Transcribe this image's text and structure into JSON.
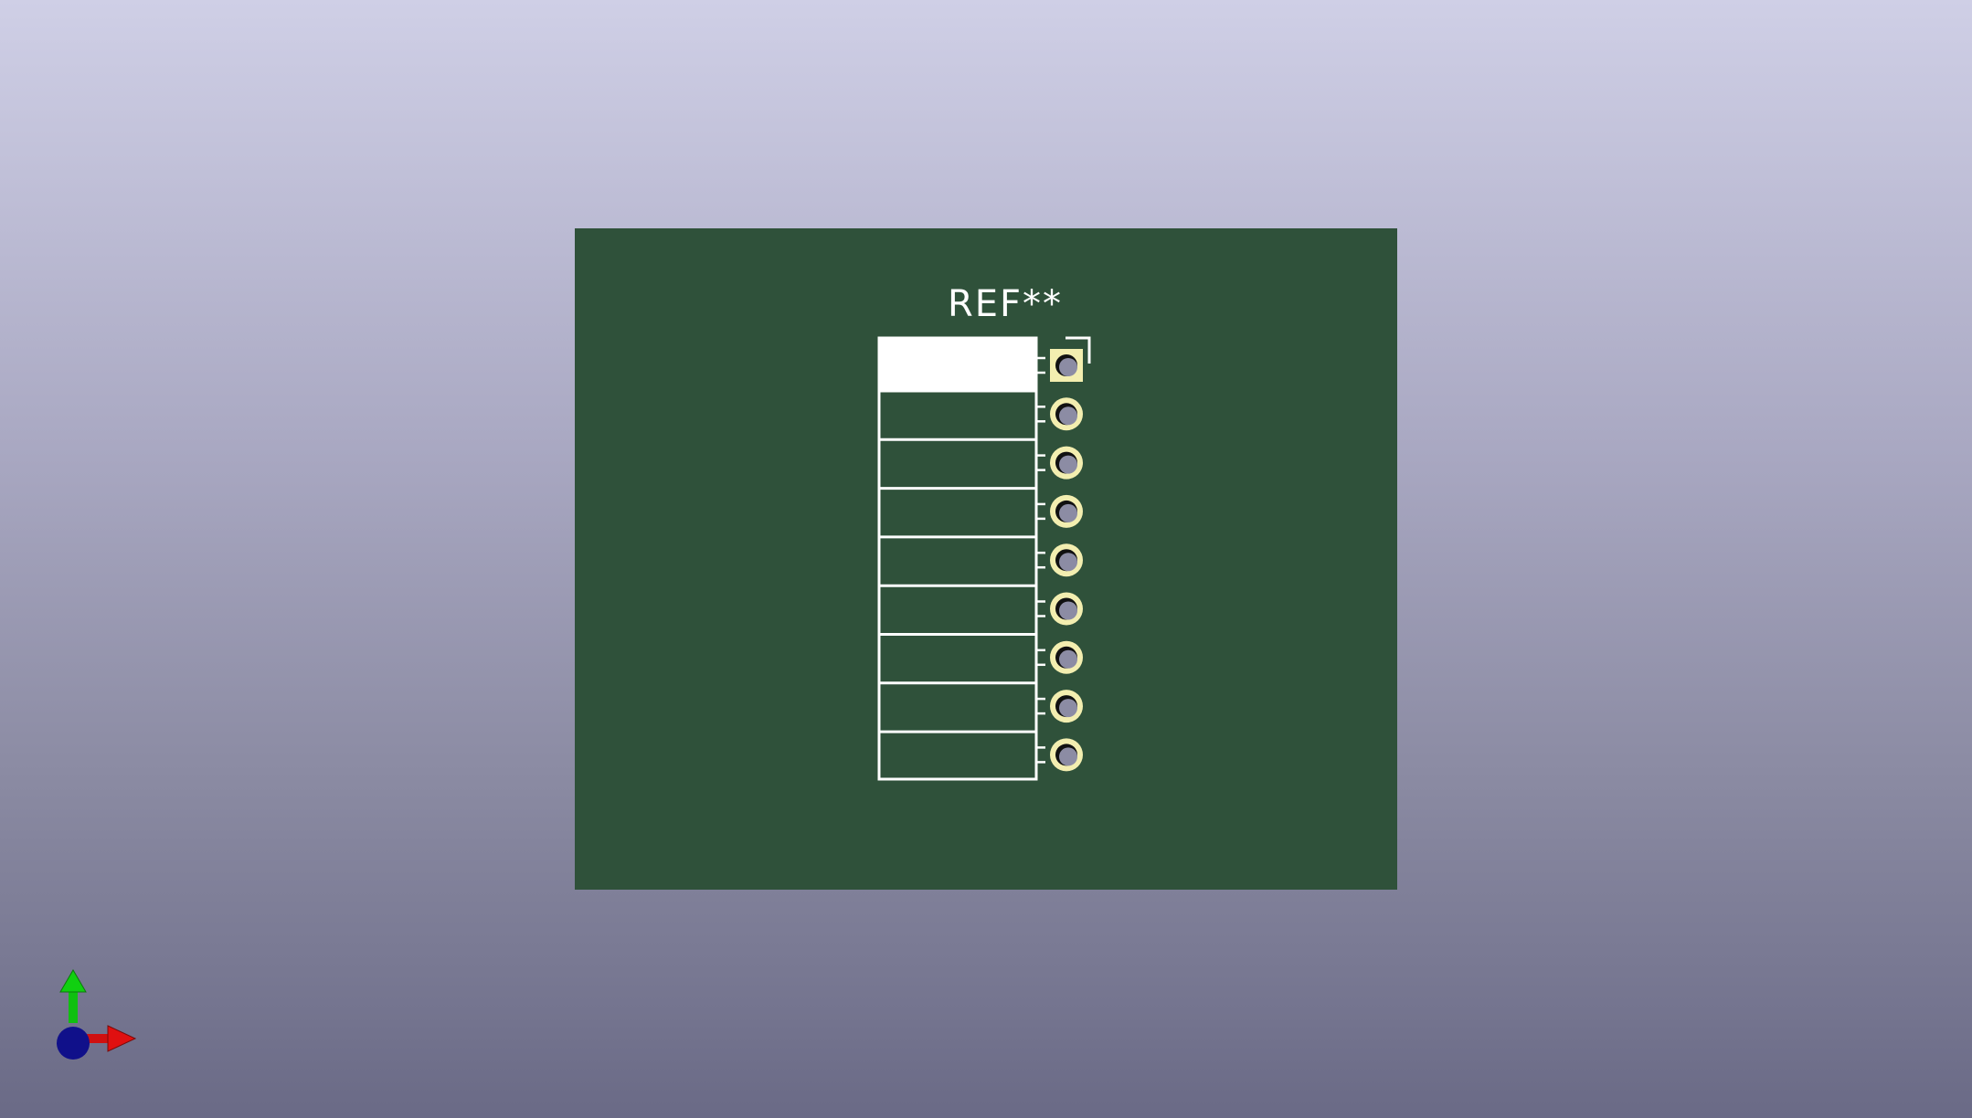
{
  "board": {
    "reference_label": "REF**",
    "pin_count": 9,
    "colors": {
      "background_top": "#cfcfe6",
      "background_bottom": "#6a6a86",
      "pcb": "#2f513a",
      "silkscreen": "#ffffff",
      "pad_copper": "#f3eeb0",
      "drill_hole": "#8c8ca4"
    }
  },
  "axis_gizmo": {
    "icons": [
      "y-axis-arrow-icon",
      "x-axis-arrow-icon",
      "z-axis-origin-icon"
    ],
    "colors": {
      "x": "#e01010",
      "y": "#10d010",
      "z": "#10108a"
    }
  }
}
